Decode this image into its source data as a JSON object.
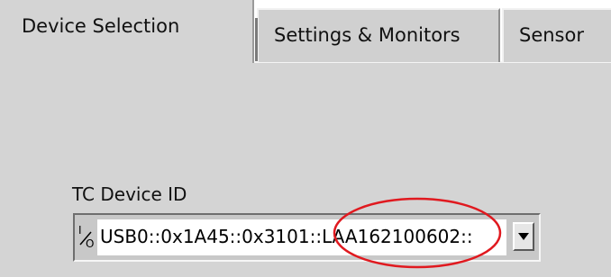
{
  "tabs": [
    {
      "label": "Device Selection",
      "active": true
    },
    {
      "label": "Settings & Monitors",
      "active": false
    },
    {
      "label": "Sensor",
      "active": false
    }
  ],
  "device_id": {
    "label": "TC Device ID",
    "value": "USB0::0x1A45::0x3101::LAA162100602::",
    "icon": "io-resource-icon"
  },
  "colors": {
    "panel": "#d4d4d4",
    "highlight_ellipse": "#e0191f"
  }
}
